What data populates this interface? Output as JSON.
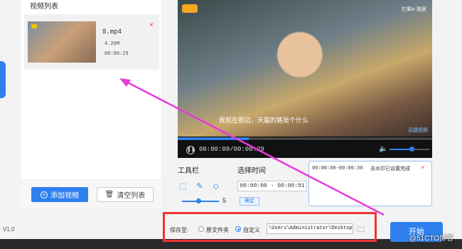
{
  "video_list": {
    "title": "视频列表",
    "item": {
      "name": "8.mp4",
      "size": "4.20M",
      "duration": "00:00:29",
      "remove_icon": "×"
    },
    "add_button": "添加视频",
    "clear_button": "清空列表"
  },
  "player": {
    "corner_logo_right": "芒果tv 独家",
    "subtitle": "我就在那边，天猫的路是个什么",
    "watermark": "迅捷视频",
    "time_display": "00:00:08/00:00:29",
    "progress_fraction": 0.28,
    "volume_fraction": 0.55
  },
  "tools": {
    "label": "工具栏",
    "select_time_label": "选择时间",
    "time_range": "00:00:00 - 00:00:01",
    "confirm_label": "确定",
    "brush_size": "5"
  },
  "log": {
    "entry_time": "00:00:00-00:00:30",
    "entry_status": "去水印已设置完成",
    "entry_close": "×"
  },
  "footer": {
    "version": "V1.0",
    "save_to_label": "保存至:",
    "option_source": "原文件夹",
    "option_custom": "自定义",
    "path": "\\Users\\Administrator\\Desktop",
    "start_button": "开始"
  },
  "watermark_site": "@51CTO博客",
  "colors": {
    "accent": "#2f80ed",
    "highlight": "#e33333",
    "arrow": "#e83adb"
  }
}
